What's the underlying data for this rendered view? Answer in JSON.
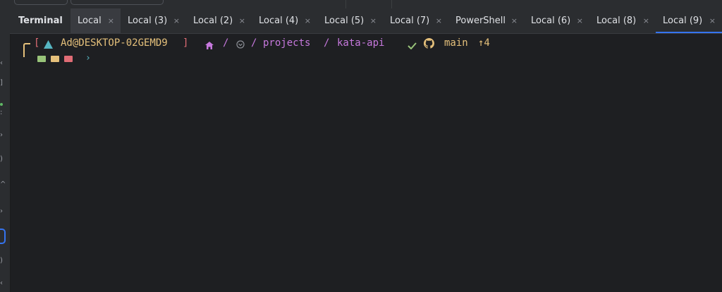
{
  "toolwindow": {
    "title": "Terminal"
  },
  "tabs": [
    {
      "label": "Local",
      "close": "×"
    },
    {
      "label": "Local (3)",
      "close": "×"
    },
    {
      "label": "Local (2)",
      "close": "×"
    },
    {
      "label": "Local (4)",
      "close": "×"
    },
    {
      "label": "Local (5)",
      "close": "×"
    },
    {
      "label": "Local (7)",
      "close": "×"
    },
    {
      "label": "PowerShell",
      "close": "×"
    },
    {
      "label": "Local (6)",
      "close": "×"
    },
    {
      "label": "Local (8)",
      "close": "×"
    },
    {
      "label": "Local (9)",
      "close": "×"
    }
  ],
  "prompt": {
    "bracket_open": "[",
    "bracket_close": "]",
    "user_host": "Ad@DESKTOP-02GEMD9",
    "path_sep": "/",
    "path_parts": [
      "projects",
      "kata-api"
    ],
    "branch": "main",
    "ahead": "↑4",
    "cursor_glyph": "›"
  },
  "colors": {
    "accent": "#3574f0",
    "prompt_yellow": "#e5c07b",
    "path_purple": "#c678dd",
    "ok_green": "#98c379",
    "cyan": "#56b6c2",
    "badge_green": "#98c379",
    "badge_yellow": "#e5c07b",
    "badge_red": "#e06c75"
  }
}
